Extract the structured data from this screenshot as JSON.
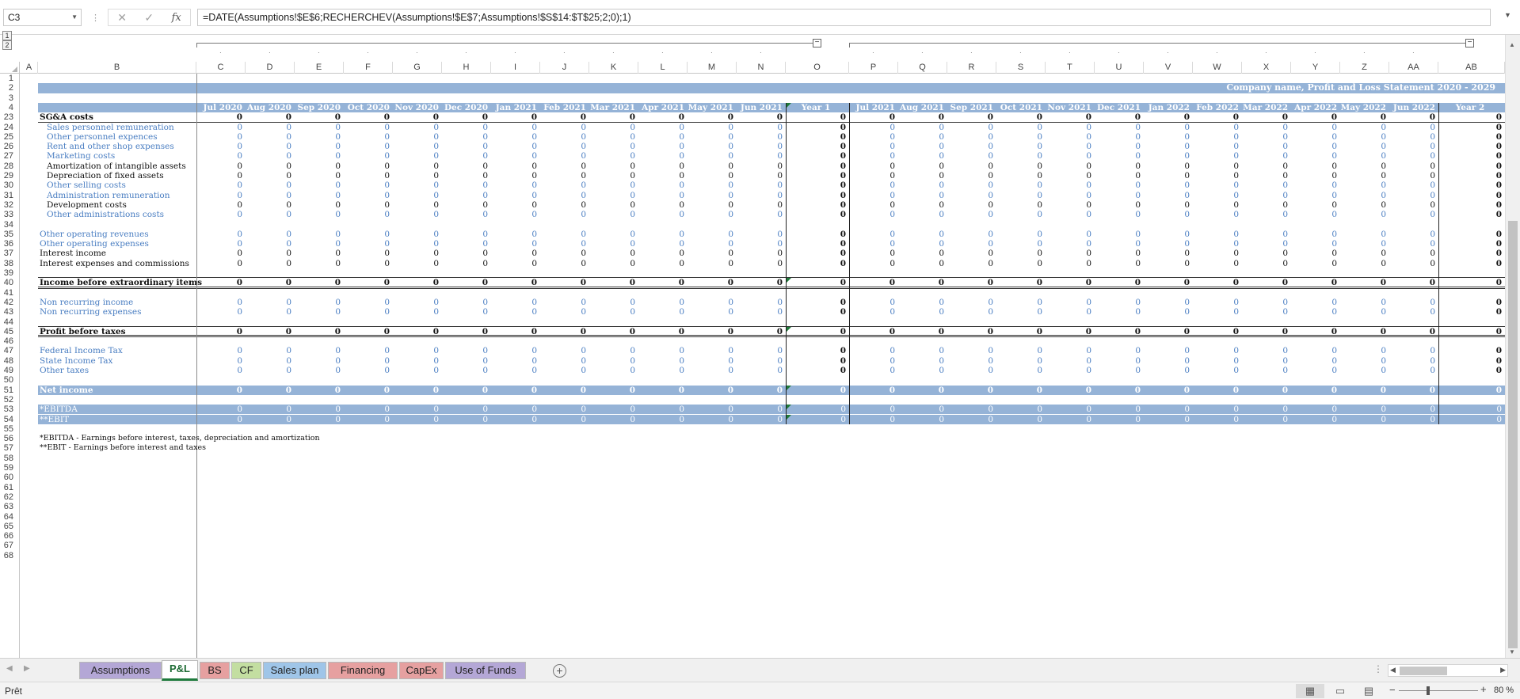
{
  "formula_bar": {
    "name_box": "C3",
    "formula": "=DATE(Assumptions!$E$6;RECHERCHEV(Assumptions!$E$7;Assumptions!$S$14:$T$25;2;0);1)"
  },
  "outline": {
    "levels": [
      "1",
      "2"
    ]
  },
  "columns": [
    "A",
    "B",
    "C",
    "D",
    "E",
    "F",
    "G",
    "H",
    "I",
    "J",
    "K",
    "L",
    "M",
    "N",
    "O",
    "P",
    "Q",
    "R",
    "S",
    "T",
    "U",
    "V",
    "W",
    "X",
    "Y",
    "Z",
    "AA",
    "AB"
  ],
  "rows_visible": [
    "1",
    "2",
    "3",
    "4",
    "23",
    "24",
    "25",
    "26",
    "27",
    "28",
    "29",
    "30",
    "31",
    "32",
    "33",
    "34",
    "35",
    "36",
    "37",
    "38",
    "39",
    "40",
    "41",
    "42",
    "43",
    "44",
    "45",
    "46",
    "47",
    "48",
    "49",
    "50",
    "51",
    "52",
    "53",
    "54",
    "55",
    "56",
    "57",
    "58",
    "59",
    "60",
    "61",
    "62",
    "63",
    "64",
    "65",
    "66",
    "67",
    "68"
  ],
  "sheet": {
    "title": "Company name, Profit and Loss Statement 2020 - 2029",
    "period_headers": [
      "Jul 2020",
      "Aug 2020",
      "Sep 2020",
      "Oct 2020",
      "Nov 2020",
      "Dec 2020",
      "Jan 2021",
      "Feb 2021",
      "Mar 2021",
      "Apr 2021",
      "May 2021",
      "Jun 2021",
      "Year 1",
      "Jul 2021",
      "Aug 2021",
      "Sep 2021",
      "Oct 2021",
      "Nov 2021",
      "Dec 2021",
      "Jan 2022",
      "Feb 2022",
      "Mar 2022",
      "Apr 2022",
      "May 2022",
      "Jun 2022",
      "Year 2"
    ],
    "cell_value": "0",
    "lines": {
      "r23": "SG&A costs",
      "r24": "Sales personnel remuneration",
      "r25": "Other personnel expences",
      "r26": "Rent and other shop expenses",
      "r27": "Marketing costs",
      "r28": "Amortization of intangible assets",
      "r29": "Depreciation of fixed assets",
      "r30": "Other selling costs",
      "r31": "Administration remuneration",
      "r32": "Development costs",
      "r33": "Other administrations costs",
      "r35": "Other operating revenues",
      "r36": "Other operating expenses",
      "r37": "Interest income",
      "r38": "Interest expenses and commissions",
      "r40": "Income before extraordinary items",
      "r42": "Non recurring income",
      "r43": "Non recurring expenses",
      "r45": "Profit before taxes",
      "r47": "Federal Income Tax",
      "r48": "State Income Tax",
      "r49": "Other taxes",
      "r51": "Net income",
      "r53": "*EBITDA",
      "r54": "**EBIT"
    },
    "notes": [
      "*EBITDA - Earnings before interest, taxes, depreciation and amortization",
      "**EBIT - Earnings before interest and taxes"
    ]
  },
  "tabs": [
    {
      "label": "Assumptions",
      "color": "#b4a7d6",
      "active": false
    },
    {
      "label": "P&L",
      "color": "#ffffff",
      "active": true
    },
    {
      "label": "BS",
      "color": "#e6a0a0",
      "active": false
    },
    {
      "label": "CF",
      "color": "#c3dea1",
      "active": false
    },
    {
      "label": "Sales plan",
      "color": "#9fc5e8",
      "active": false
    },
    {
      "label": "Financing",
      "color": "#e6a0a0",
      "active": false
    },
    {
      "label": "CapEx",
      "color": "#e6a0a0",
      "active": false
    },
    {
      "label": "Use of Funds",
      "color": "#b4a7d6",
      "active": false
    }
  ],
  "status": {
    "text": "Prêt",
    "zoom": "80 %"
  },
  "colors": {
    "band": "#95b3d7",
    "light_text": "#4a7ec2",
    "active_tab_accent": "#1e7a3c"
  }
}
